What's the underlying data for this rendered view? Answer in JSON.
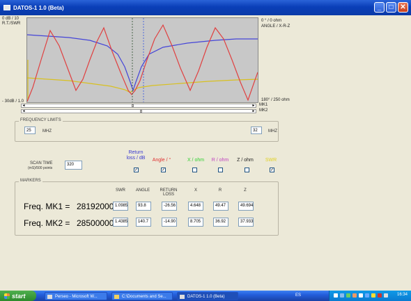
{
  "window": {
    "title": "DATOS-1 1.0 (Beta)",
    "buttons": {
      "minimize": "_",
      "maximize": "□",
      "close": "✕"
    }
  },
  "plot": {
    "left_top": "0 dB / 10",
    "left_sub": "R.T./SWR",
    "left_bottom": "- 30dB / 1.0",
    "right_top": "0 ° / 0 ohm",
    "right_sub": "ANGLE / X-R-Z",
    "right_bottom": "180° / 250 ohm",
    "colors": {
      "return_loss": "#4444d8",
      "angle": "#e04040",
      "swr": "#d8c020",
      "marker1": "#2a4a2a",
      "marker2": "#3050e0"
    }
  },
  "sliders": {
    "mk1": "MK1",
    "mk2": "MK2"
  },
  "frequency_limits": {
    "title": "FREQUENCY LIMITS",
    "low_value": "25",
    "low_unit": "MHZ",
    "high_value": "32",
    "high_unit": "MHZ"
  },
  "scan": {
    "label": "SCAN TIME",
    "sublabel": "(mS)/500 points",
    "value": "320"
  },
  "curves": [
    {
      "label": "Return loss / dB",
      "color": "#3a3ad0",
      "checked": true
    },
    {
      "label": "Angle / °",
      "color": "#e03030",
      "checked": true
    },
    {
      "label": "X / ohm",
      "color": "#30d030",
      "checked": false
    },
    {
      "label": "R / ohm",
      "color": "#c040c0",
      "checked": false
    },
    {
      "label": "Z / ohm",
      "color": "#202020",
      "checked": false
    },
    {
      "label": "SWR",
      "color": "#e0d020",
      "checked": true
    }
  ],
  "markers": {
    "title": "MARKERS",
    "columns": [
      "SWR",
      "ANGLE",
      "RETURN LOSS",
      "X",
      "R",
      "Z"
    ],
    "rows": [
      {
        "label": "Freq. MK1 =",
        "freq": "28192000",
        "values": [
          "1.0985",
          "93.8",
          "-26.56",
          "4.648",
          "49.47",
          "49.694"
        ]
      },
      {
        "label": "Freq. MK2 =",
        "freq": "28500000",
        "values": [
          "1.4385",
          "140.7",
          "-14.90",
          "8.705",
          "36.92",
          "37.933"
        ]
      }
    ]
  },
  "taskbar": {
    "start": "start",
    "tasks": [
      "Perseo - Microsoft W...",
      "C:\\Documents and Se...",
      "DATOS-1 1.0 (Beta)"
    ],
    "lang": "ES",
    "clock": "16:34"
  }
}
